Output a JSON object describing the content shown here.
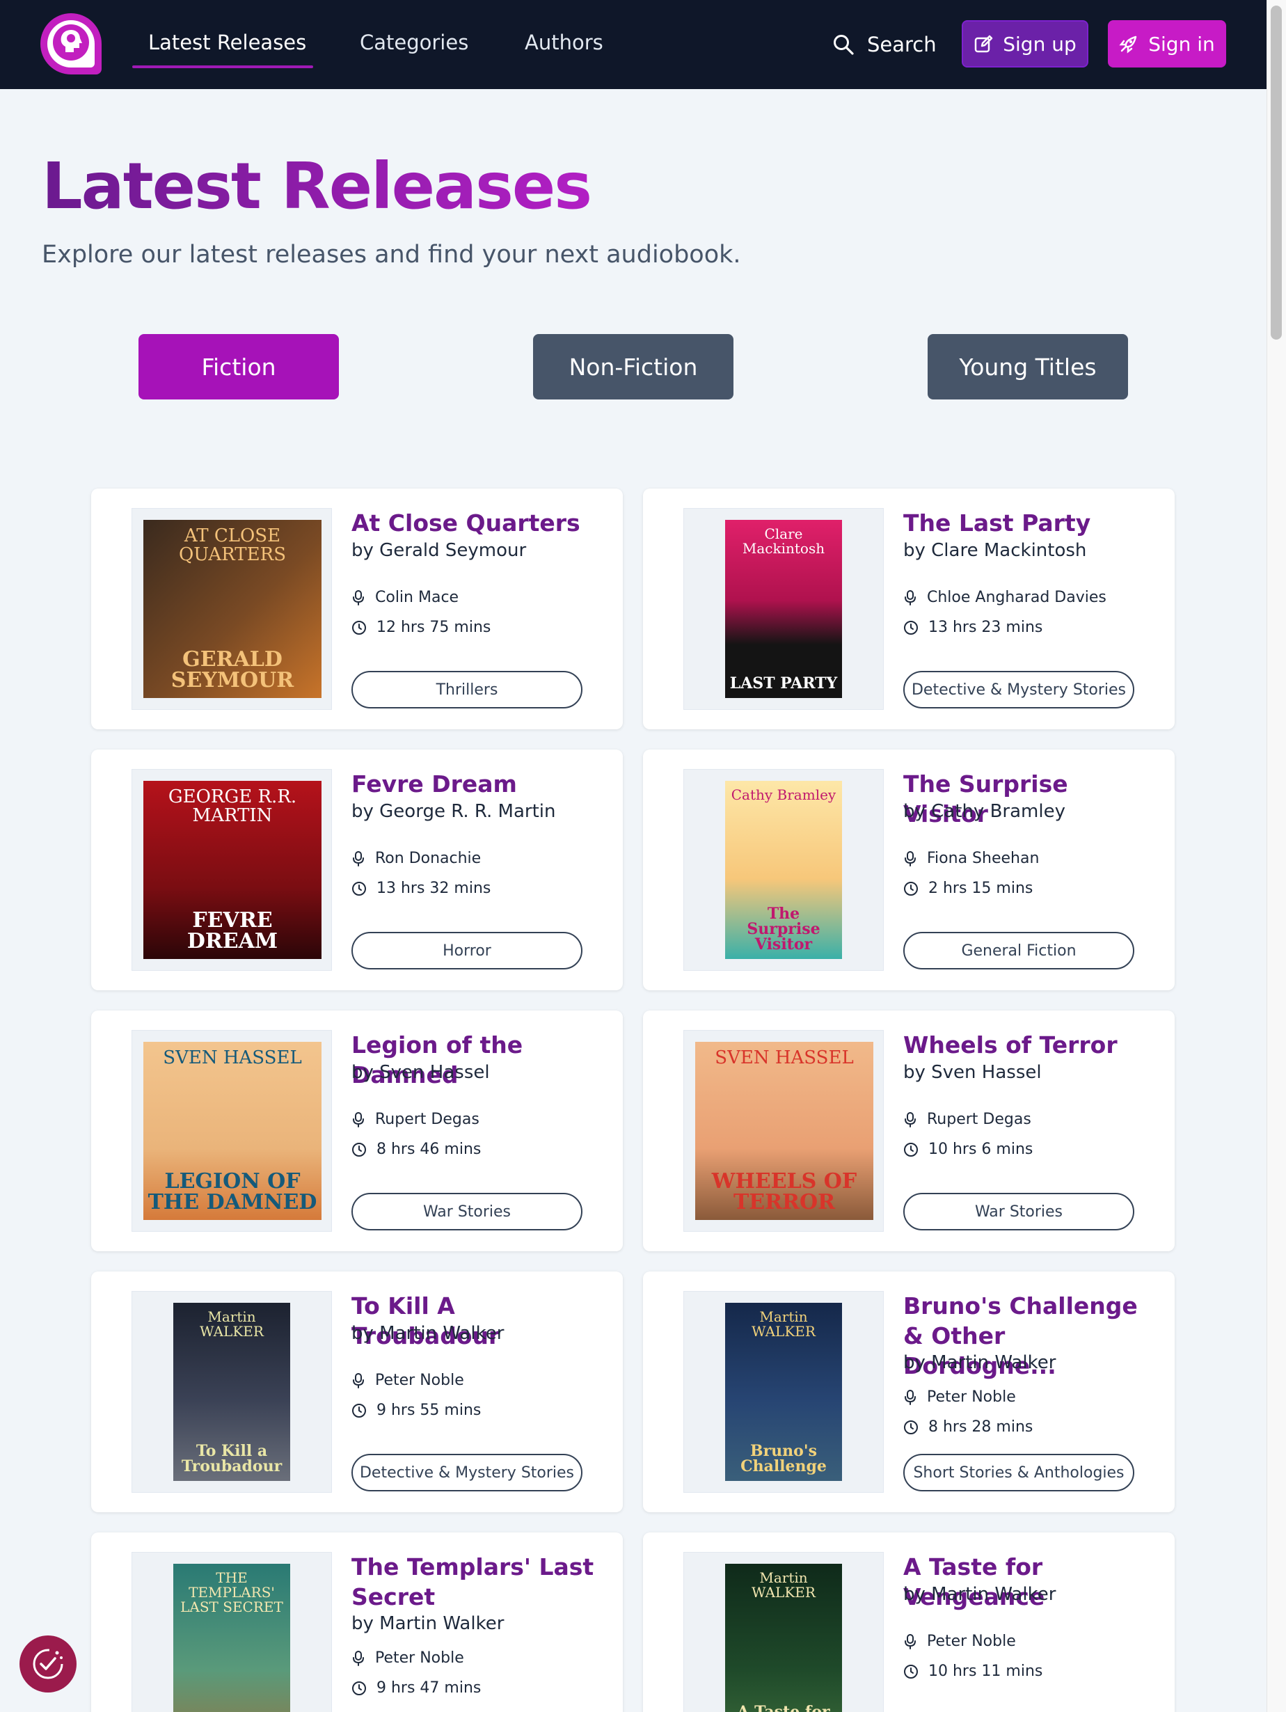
{
  "nav": {
    "links": [
      "Latest Releases",
      "Categories",
      "Authors"
    ],
    "search_label": "Search",
    "signup_label": "Sign up",
    "signin_label": "Sign in"
  },
  "hero": {
    "title": "Latest Releases",
    "subtitle": "Explore our latest releases and find your next audiobook."
  },
  "tabs": [
    "Fiction",
    "Non-Fiction",
    "Young Titles"
  ],
  "colors": {
    "brand": "#a612b8",
    "nav_bg": "#0f1729",
    "title_purple": "#6b1a8a",
    "tab_inactive": "#475569"
  },
  "books": [
    {
      "title": "At Close Quarters",
      "by": "by",
      "author": "Gerald Seymour",
      "narrator": "Colin Mace",
      "duration": "12 hrs 75 mins",
      "genre": "Thrillers",
      "cover": {
        "top": "AT CLOSE QUARTERS",
        "bottom": "GERALD SEYMOUR",
        "bg": "linear-gradient(135deg,#3a2a1e 0%,#7a4a24 55%,#c8742a 100%)",
        "color": "#f4c27a"
      }
    },
    {
      "title": "The Last Party",
      "by": "by",
      "author": "Clare Mackintosh",
      "narrator": "Chloe Angharad Davies",
      "duration": "13 hrs 23 mins",
      "genre": "Detective & Mystery Stories",
      "cover": {
        "top": "Clare Mackintosh",
        "bottom": "LAST PARTY",
        "bg": "linear-gradient(180deg,#e0206a 0%,#b0124e 45%,#141414 70%)",
        "color": "#ffffff"
      }
    },
    {
      "title": "Fevre Dream",
      "by": "by",
      "author": "George R. R. Martin",
      "narrator": "Ron Donachie",
      "duration": "13 hrs 32 mins",
      "genre": "Horror",
      "cover": {
        "top": "GEORGE R.R. MARTIN",
        "bottom": "FEVRE DREAM",
        "bg": "linear-gradient(180deg,#b5121b 0%,#7a0d12 60%,#2b0608 100%)",
        "color": "#ffffff"
      }
    },
    {
      "title": "The Surprise Visitor",
      "by": "by",
      "author": "Cathy Bramley",
      "narrator": "Fiona Sheehan",
      "duration": "2 hrs 15 mins",
      "genre": "General Fiction",
      "cover": {
        "top": "Cathy Bramley",
        "bottom": "The Surprise Visitor",
        "bg": "linear-gradient(180deg,#fde7a8 0%,#f7c77a 55%,#3ab0a8 100%)",
        "color": "#c0186e"
      }
    },
    {
      "title": "Legion of the Damned",
      "by": "by",
      "author": "Sven Hassel",
      "narrator": "Rupert Degas",
      "duration": "8 hrs 46 mins",
      "genre": "War Stories",
      "cover": {
        "top": "SVEN HASSEL",
        "bottom": "LEGION OF THE DAMNED",
        "bg": "linear-gradient(180deg,#f3c58e 0%,#eab47a 60%,#d57a3a 100%)",
        "color": "#155a7a"
      }
    },
    {
      "title": "Wheels of Terror",
      "by": "by",
      "author": "Sven Hassel",
      "narrator": "Rupert Degas",
      "duration": "10 hrs 6 mins",
      "genre": "War Stories",
      "cover": {
        "top": "SVEN HASSEL",
        "bottom": "WHEELS OF TERROR",
        "bg": "linear-gradient(180deg,#f1b98a 0%,#e9a073 60%,#8a5a3a 100%)",
        "color": "#d8342a"
      }
    },
    {
      "title": "To Kill A Troubadour",
      "by": "by",
      "author": "Martin Walker",
      "narrator": "Peter Noble",
      "duration": "9 hrs 55 mins",
      "genre": "Detective & Mystery Stories",
      "cover": {
        "top": "Martin WALKER",
        "bottom": "To Kill a Troubadour",
        "bg": "linear-gradient(180deg,#1c2230 0%,#3b4256 55%,#6a6f7a 100%)",
        "color": "#e9e6a6"
      }
    },
    {
      "title": "Bruno's Challenge & Other Dordogne...",
      "by": "by",
      "author": "Martin Walker",
      "narrator": "Peter Noble",
      "duration": "8 hrs 28 mins",
      "genre": "Short Stories & Anthologies",
      "cover": {
        "top": "Martin WALKER",
        "bottom": "Bruno's Challenge",
        "bg": "linear-gradient(180deg,#15284a 0%,#274573 55%,#3a5f7a 100%)",
        "color": "#f2d27a"
      }
    },
    {
      "title": "The Templars' Last Secret",
      "by": "by",
      "author": "Martin Walker",
      "narrator": "Peter Noble",
      "duration": "9 hrs 47 mins",
      "genre": "",
      "cover": {
        "top": "THE TEMPLARS' LAST SECRET",
        "bottom": "",
        "bg": "linear-gradient(180deg,#2a7a74 0%,#5a9a7a 60%,#8a7a4a 100%)",
        "color": "#f4e7b0"
      }
    },
    {
      "title": "A Taste for Vengeance",
      "by": "by",
      "author": "Martin Walker",
      "narrator": "Peter Noble",
      "duration": "10 hrs 11 mins",
      "genre": "",
      "cover": {
        "top": "Martin WALKER",
        "bottom": "A Taste for Vengeance",
        "bg": "linear-gradient(180deg,#0f2a1a 0%,#1f4a2a 60%,#3a6a3a 100%)",
        "color": "#f2e6b0"
      }
    }
  ]
}
